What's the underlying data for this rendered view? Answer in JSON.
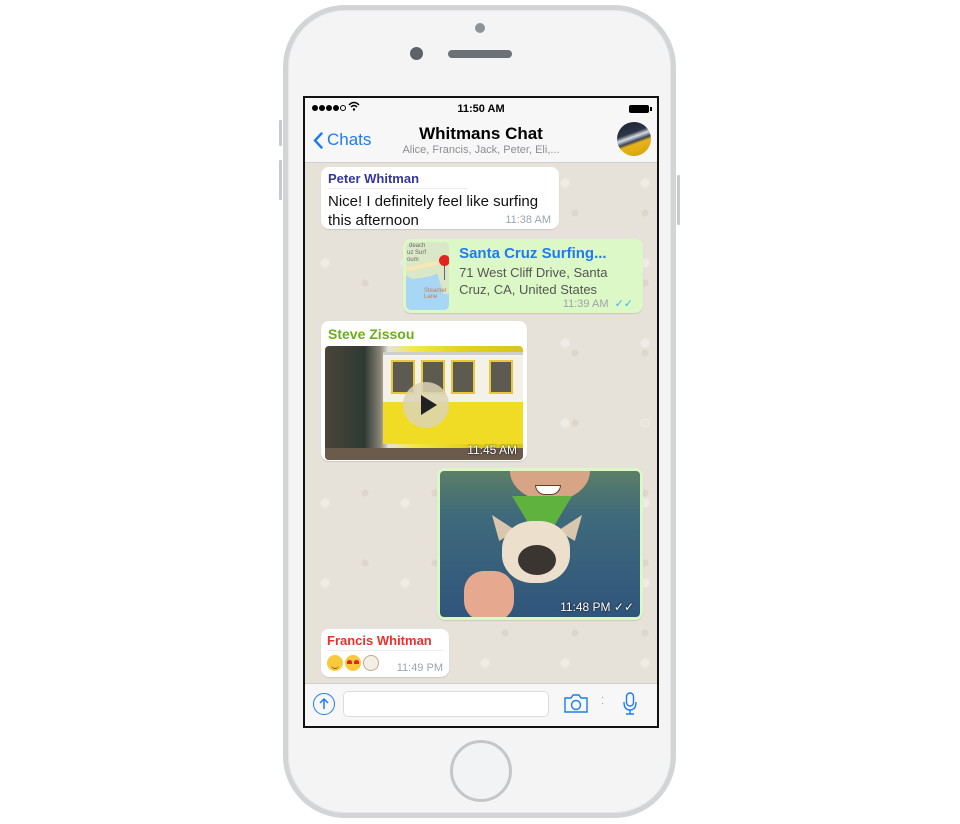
{
  "status_bar": {
    "time": "11:50 AM",
    "signal_bars": 4,
    "signal_total": 5,
    "icons": [
      "signal-icon",
      "wifi-icon",
      "battery-icon"
    ]
  },
  "nav": {
    "back_label": "Chats",
    "title": "Whitmans Chat",
    "subtitle": "Alice, Francis, Jack, Peter, Eli,..."
  },
  "colors": {
    "accent": "#1e7bf2",
    "incoming_bubble": "#ffffff",
    "outgoing_bubble": "#dcf8c6",
    "chat_background": "#e7e2d9",
    "read_ticks": "#34b7f1"
  },
  "messages": [
    {
      "type": "text",
      "direction": "incoming",
      "sender": "Peter Whitman",
      "sender_color": "#35379e",
      "text": "Nice! I definitely feel like surfing this afternoon",
      "time": "11:38 AM"
    },
    {
      "type": "location",
      "direction": "outgoing",
      "title": "Santa Cruz Surfing...",
      "address": "71 West Cliff Drive, Santa Cruz, CA, United States",
      "map_labels": [
        "deach",
        "uz Surf",
        "oum",
        "Steamer Lane"
      ],
      "time": "11:39 AM",
      "status": "read"
    },
    {
      "type": "video",
      "direction": "incoming",
      "sender": "Steve Zissou",
      "sender_color": "#6cad1e",
      "time": "11:45 AM"
    },
    {
      "type": "photo",
      "direction": "outgoing",
      "time": "11:48 PM",
      "status": "delivered"
    },
    {
      "type": "emoji",
      "direction": "incoming",
      "sender": "Francis Whitman",
      "sender_color": "#e9322a",
      "emojis": [
        "relieved-face",
        "heart-eyes-face",
        "dog-face"
      ],
      "time": "11:49 PM"
    }
  ],
  "input_bar": {
    "placeholder": "",
    "value": ""
  }
}
